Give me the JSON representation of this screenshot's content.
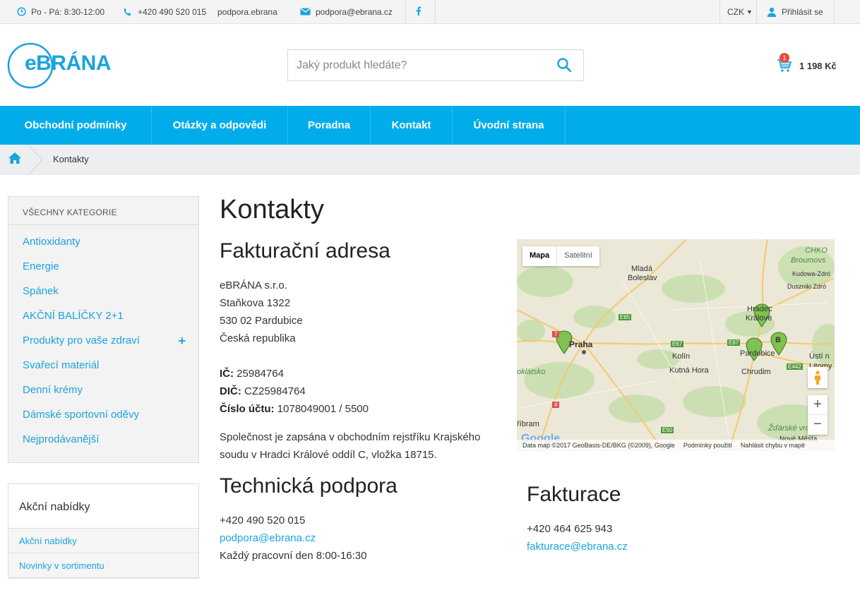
{
  "topbar": {
    "hours": "Po - Pá: 8:30-12:00",
    "phone": "+420 490 520 015",
    "skype": "podpora.ebrana",
    "email": "podpora@ebrana.cz",
    "currency": "CZK",
    "login": "Přihlásit se"
  },
  "header": {
    "logo_text": "eBRÁNA",
    "search_placeholder": "Jaký produkt hledáte?",
    "cart_count": "1",
    "cart_total": "1 198 Kč"
  },
  "nav": [
    "Obchodní podmínky",
    "Otázky a odpovědi",
    "Poradna",
    "Kontakt",
    "Úvodní strana"
  ],
  "breadcrumb": {
    "current": "Kontakty"
  },
  "sidebar": {
    "title": "VŠECHNY KATEGORIE",
    "items": [
      "Antioxidanty",
      "Energie",
      "Spánek",
      "AKČNÍ BALÍČKY 2+1",
      "Produkty pro vaše zdraví",
      "Svařecí materiál",
      "Denní krémy",
      "Dámské sportovní oděvy",
      "Nejprodávanější"
    ],
    "expand_symbol": "+",
    "promo_title": "Akční nabídky",
    "promo_links": [
      "Akční nabídky",
      "Novinky v sortimentu"
    ]
  },
  "content": {
    "title": "Kontakty",
    "billing": {
      "heading": "Fakturační adresa",
      "company": "eBRÁNA s.r.o.",
      "street": "Staňkova 1322",
      "city": "530 02 Pardubice",
      "country": "Česká republika",
      "ic_label": "IČ:",
      "ic": "25984764",
      "dic_label": "DIČ:",
      "dic": "CZ25984764",
      "account_label": "Číslo účtu:",
      "account": "1078049001 / 5500",
      "note_line1": "Společnost je zapsána v obchodním rejstříku Krajského",
      "note_line2": "soudu v Hradci Králové oddíl C, vložka 18715."
    },
    "support": {
      "heading": "Technická podpora",
      "phone": "+420 490 520 015",
      "email": "podpora@ebrana.cz",
      "hours": "Každý pracovní den 8:00-16:30"
    },
    "invoicing": {
      "heading": "Fakturace",
      "phone": "+420 464 625 943",
      "email": "fakturace@ebrana.cz"
    }
  },
  "map": {
    "type_map": "Mapa",
    "type_sat": "Satelitní",
    "zoom_in": "+",
    "zoom_out": "−",
    "marker_b": "B",
    "labels": {
      "mlada": "Mladá",
      "boleslav": "Boleslav",
      "chko": "CHKO",
      "broumov": "Broumovs",
      "kudowa": "Kudowa-Zdró",
      "dusznik": "Duszniki Zdró",
      "hradec": "Hradec",
      "kralove": "Králové",
      "praha": "Praha",
      "pardubice": "Pardubice",
      "kolin": "Kolín",
      "kutna": "Kutná Hora",
      "chrudim": "Chrudim",
      "usti": "Ústí n",
      "litomy": "Litomy",
      "zdarske": "Žďárské vrchy",
      "nove": "Nové Města",
      "pribram": "říbram",
      "kladsko": "oklátsko",
      "e65": "E65",
      "e67a": "E67",
      "e67b": "E67",
      "e442": "E442",
      "e50": "E50",
      "r7": "7",
      "r4": "4",
      "google": "Google"
    },
    "footer": [
      "Data map ©2017 GeoBasis-DE/BKG (©2009), Google",
      "Podmínky použití",
      "Nahlásit chybu v mapě"
    ]
  }
}
